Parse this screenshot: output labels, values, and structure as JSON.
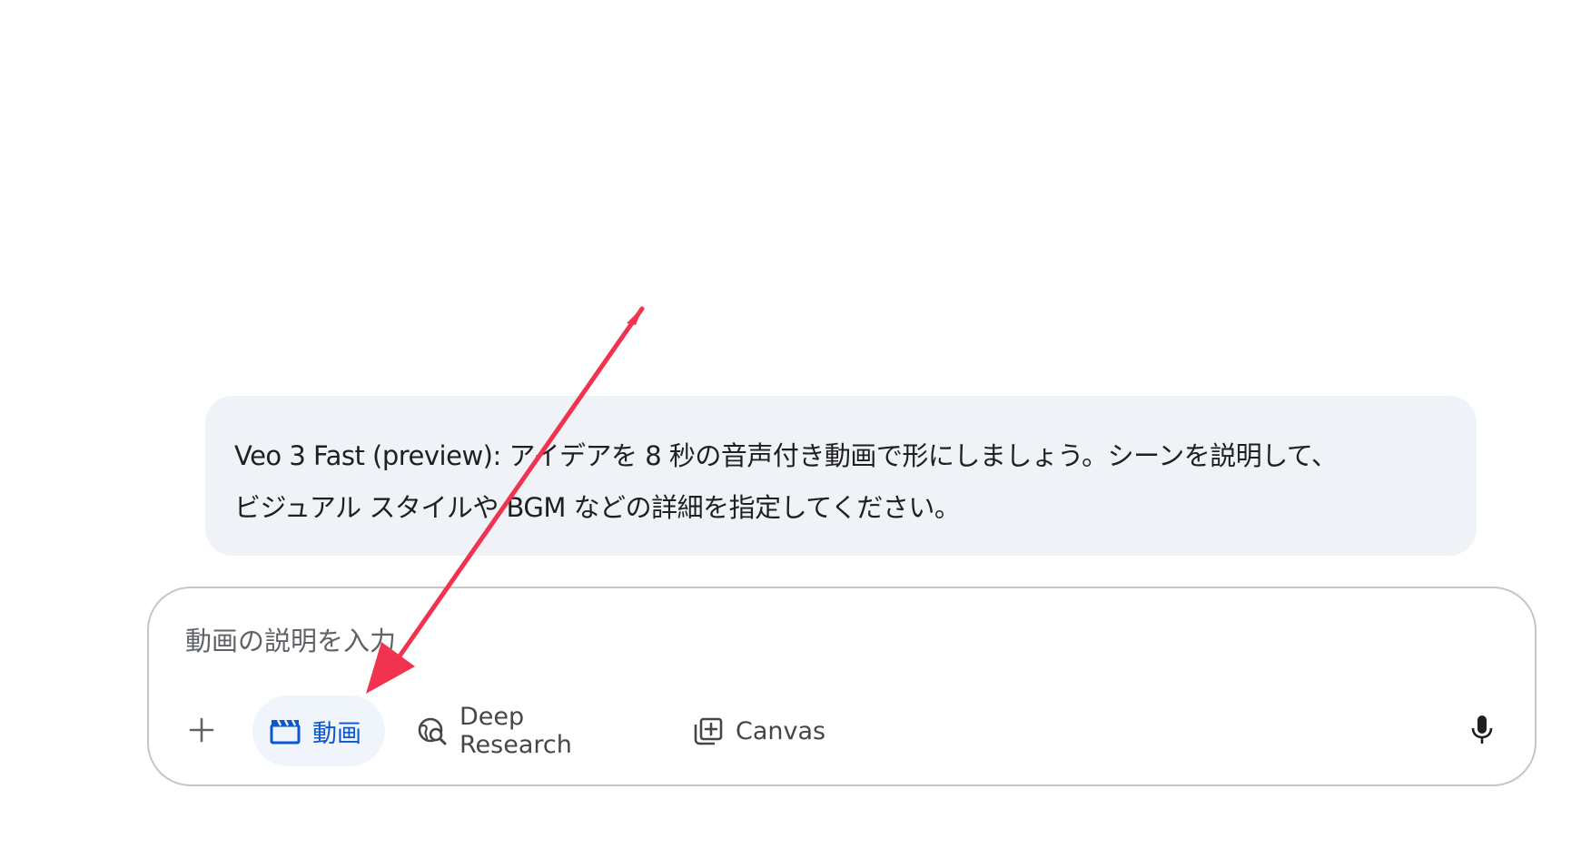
{
  "info_bubble": {
    "line1": "Veo 3 Fast (preview): アイデアを 8 秒の音声付き動画で形にしましょう。シーンを説明して、",
    "line2": "ビジュアル スタイルや BGM などの詳細を指定してください。"
  },
  "composer": {
    "placeholder": "動画の説明を入力",
    "value": ""
  },
  "toolbar": {
    "add_icon": "plus-icon",
    "chips": [
      {
        "label": "動画",
        "icon": "clapperboard-icon",
        "selected": true
      },
      {
        "label": "Deep Research",
        "icon": "globe-search-icon",
        "selected": false
      },
      {
        "label": "Canvas",
        "icon": "canvas-add-icon",
        "selected": false
      }
    ],
    "mic_icon": "microphone-icon"
  },
  "colors": {
    "bubble_bg": "#eff2f7",
    "selected_chip_bg": "#f0f4fb",
    "selected_chip_text": "#0b57d0",
    "chip_text": "#444746",
    "composer_border": "#c4c7c5",
    "annotation_arrow": "#f2334f"
  }
}
